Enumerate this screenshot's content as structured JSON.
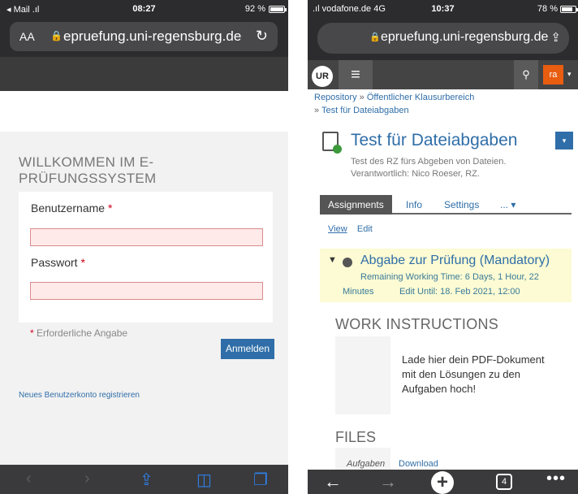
{
  "left": {
    "status": {
      "carrier": "◂ Mail .ıl",
      "time": "08:27",
      "battery": "92 %",
      "battery_level": 0.92
    },
    "browser": {
      "aa": "AA",
      "url": "epruefung.uni-regensburg.de"
    },
    "welcome_title": "WILLKOMMEN IM E-PRÜFUNGSSYSTEM",
    "form": {
      "username_label": "Benutzername",
      "password_label": "Passwort",
      "required_star": "*",
      "required_note": "Erforderliche Angabe",
      "submit": "Anmelden"
    },
    "register_link": "Neues Benutzerkonto registrieren",
    "toolbar": {
      "back": "‹",
      "forward": "›",
      "share": "⇪",
      "bookmarks": "◫",
      "tabs": "❐"
    }
  },
  "right": {
    "status": {
      "carrier": ".ıl vodafone.de 4G",
      "time": "10:37",
      "battery": "78 %",
      "battery_level": 0.78
    },
    "browser": {
      "url": "epruefung.uni-regensburg.de",
      "share": "⇪"
    },
    "header": {
      "logo": "UR",
      "menu": "≡",
      "search": "⚲",
      "avatar": "ra",
      "avatar_caret": "▾"
    },
    "breadcrumb": {
      "items": [
        "Repository",
        "Öffentlicher Klausurbereich",
        "Test für Dateiabgaben"
      ],
      "separator": "»"
    },
    "object": {
      "title": "Test für Dateiabgaben",
      "description": "Test des RZ fürs Abgeben von Dateien.",
      "responsible": "Verantwortlich: Nico Roeser, RZ.",
      "action_caret": "▾"
    },
    "tabs": [
      "Assignments",
      "Info",
      "Settings",
      "... ▾"
    ],
    "subtabs": [
      "View",
      "Edit"
    ],
    "assignment": {
      "caret": "▼",
      "title": "Abgabe zur Prüfung (Mandatory)",
      "remaining": "Remaining Working Time: 6 Days, 1 Hour, 22",
      "remaining_cont": "Minutes",
      "edit_until": "Edit Until: 18. Feb 2021, 12:00"
    },
    "work_instructions": {
      "heading": "WORK INSTRUCTIONS",
      "text": "Lade hier dein PDF-Dokument mit den Lösungen zu den Aufgaben hoch!"
    },
    "files": {
      "heading": "FILES",
      "filename": "Aufgaben",
      "download": "Download"
    },
    "toolbar": {
      "back": "←",
      "forward": "→",
      "new": "+",
      "tabs_count": "4",
      "more": "•••"
    }
  }
}
